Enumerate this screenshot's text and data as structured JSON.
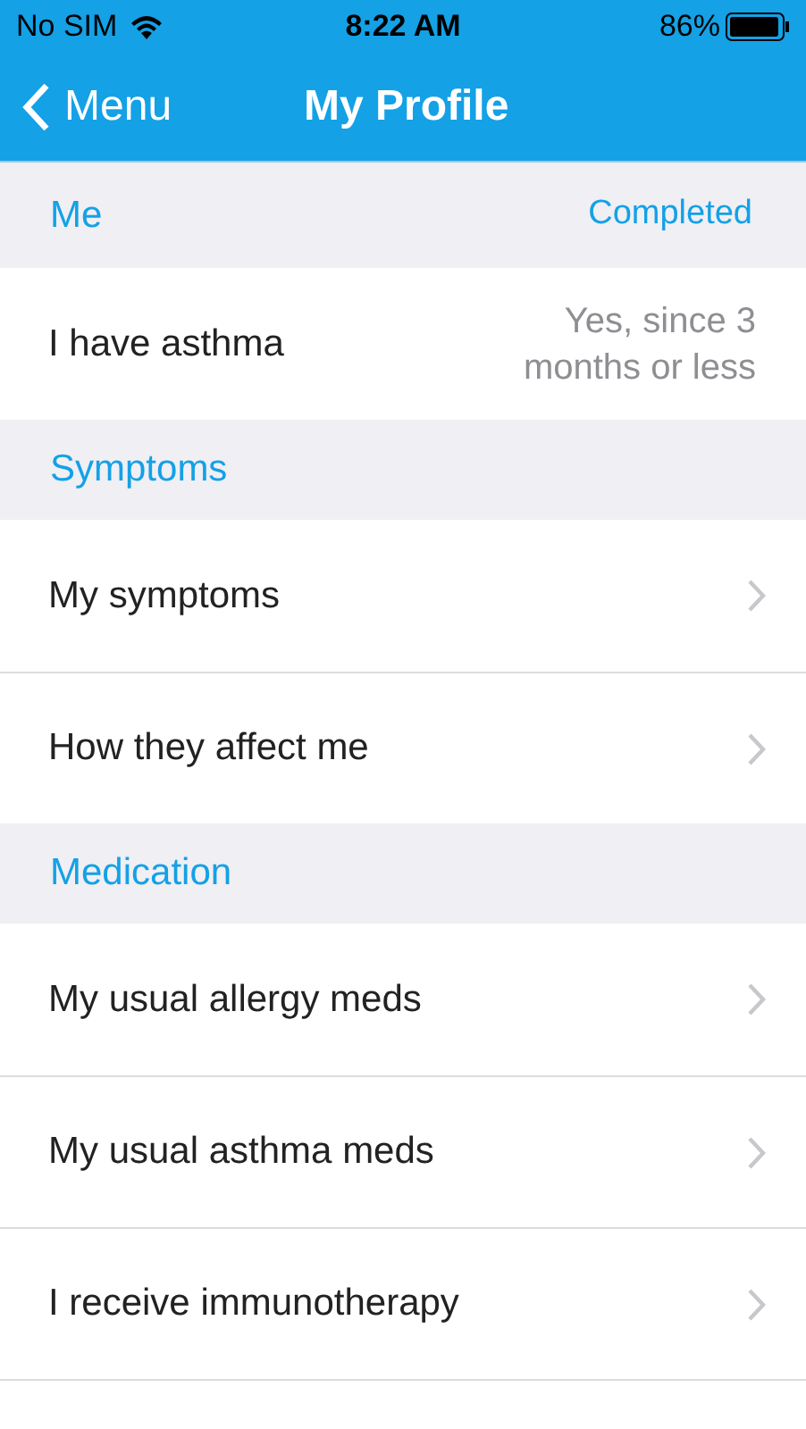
{
  "status_bar": {
    "carrier": "No SIM",
    "time": "8:22 AM",
    "battery": "86%"
  },
  "nav": {
    "back": "Menu",
    "title": "My Profile"
  },
  "sections": [
    {
      "title": "Me",
      "status": "Completed",
      "rows": [
        {
          "kind": "value",
          "label": "I have asthma",
          "value": "Yes, since 3 months or less"
        }
      ]
    },
    {
      "title": "Symptoms",
      "rows": [
        {
          "kind": "link",
          "label": "My symptoms"
        },
        {
          "kind": "link",
          "label": "How they affect me"
        }
      ]
    },
    {
      "title": "Medication",
      "rows": [
        {
          "kind": "link",
          "label": "My usual allergy meds"
        },
        {
          "kind": "link",
          "label": "My usual asthma meds"
        },
        {
          "kind": "link",
          "label": "I receive immunotherapy"
        }
      ]
    }
  ]
}
